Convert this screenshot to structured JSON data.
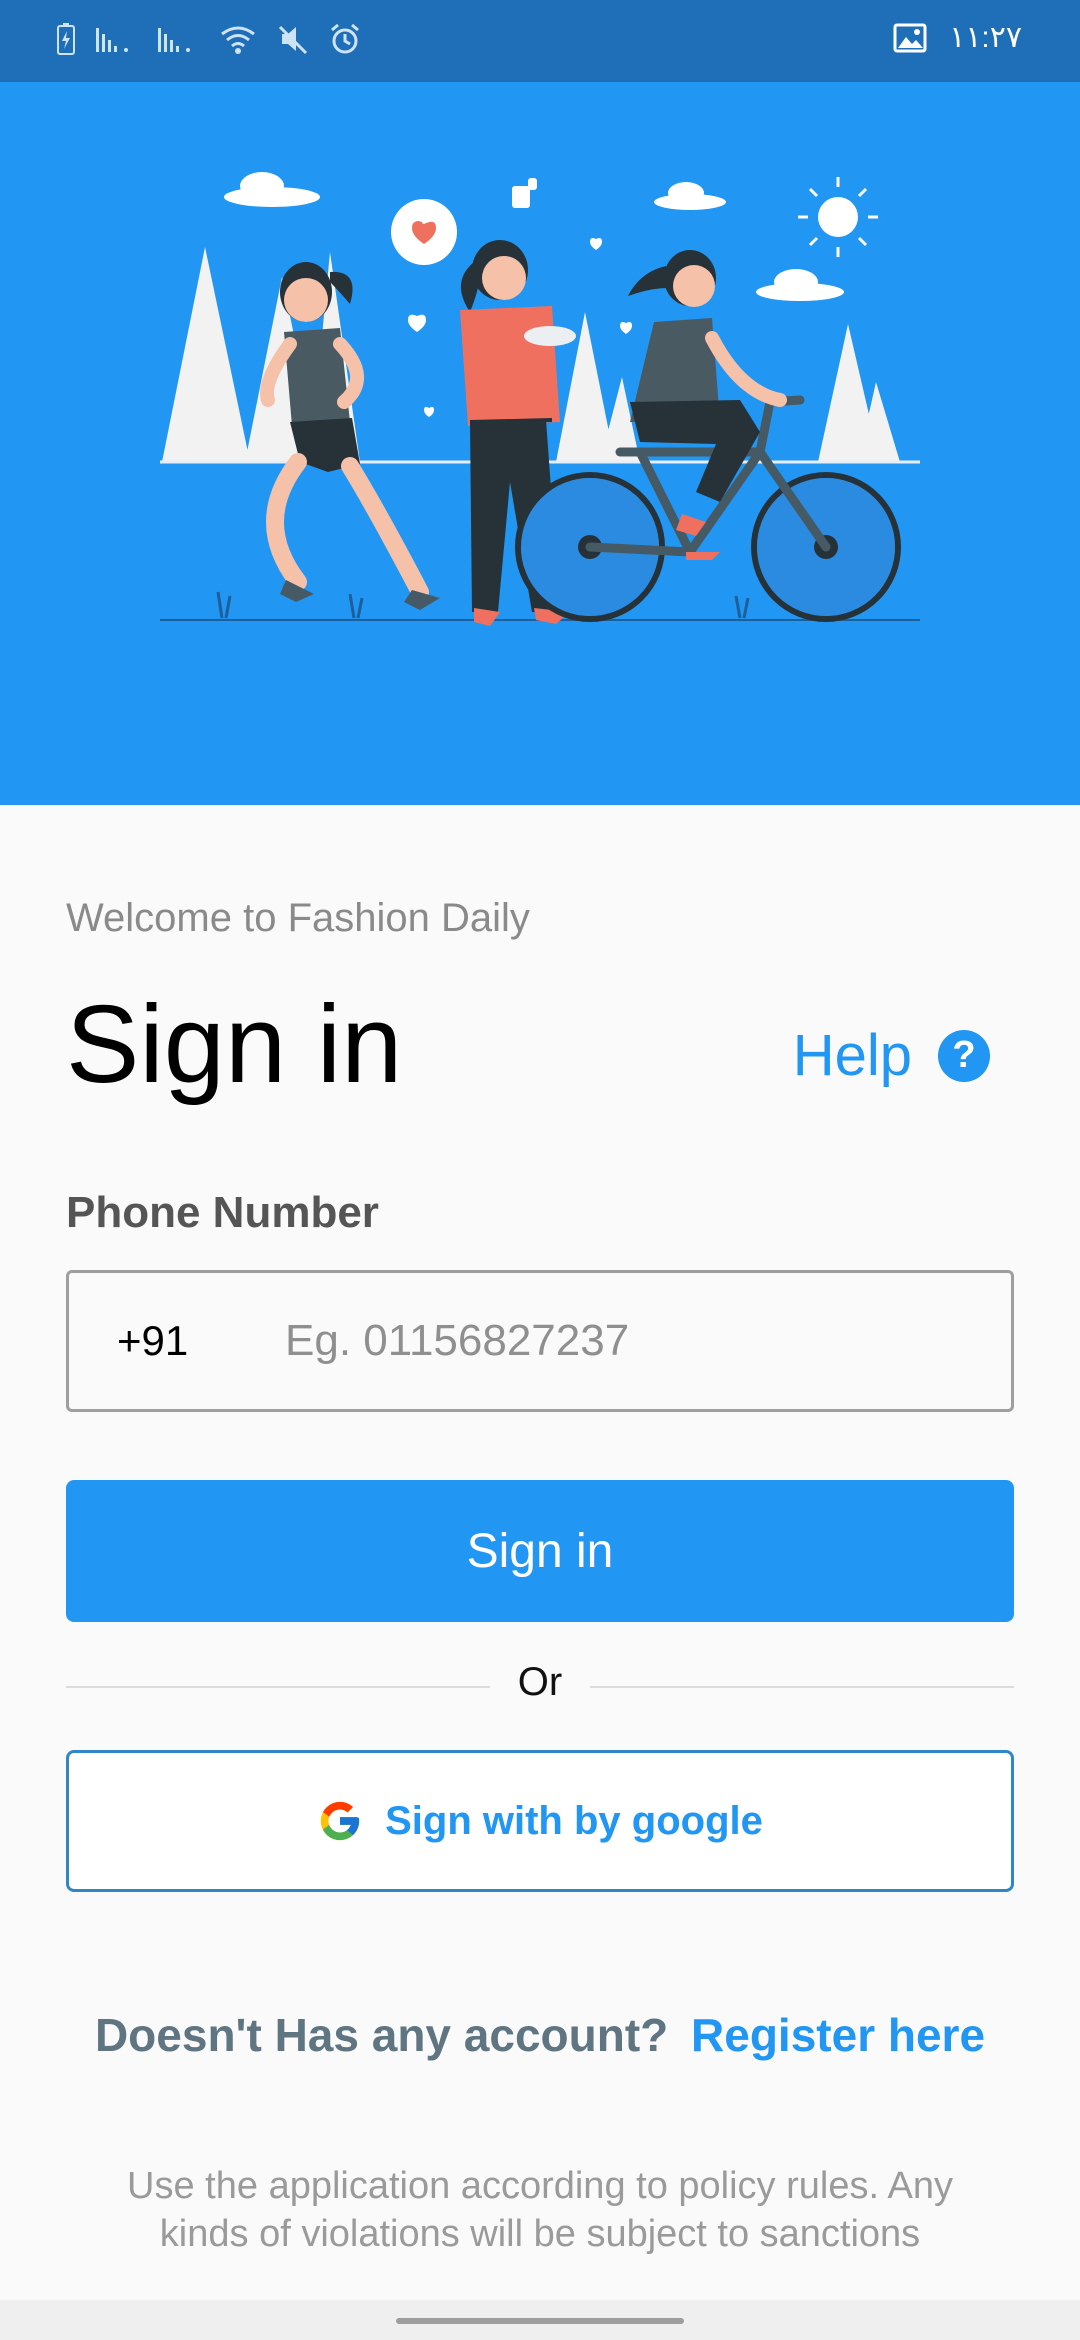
{
  "status_bar": {
    "time": "١١:٢٧",
    "icons": [
      "battery-charging-icon",
      "signal-icon",
      "signal-icon",
      "wifi-icon",
      "mute-icon",
      "alarm-icon",
      "image-icon"
    ]
  },
  "hero": {
    "illustration": "people-exercising-illustration",
    "background_color": "#2196f3"
  },
  "welcome_text": "Welcome to Fashion Daily",
  "title": "Sign in",
  "help": {
    "label": "Help",
    "icon": "help-icon"
  },
  "phone": {
    "label": "Phone Number",
    "country_code": "+91",
    "placeholder": "Eg. 01156827237",
    "value": ""
  },
  "signin_button": "Sign in",
  "divider_text": "Or",
  "google_button": {
    "label": "Sign with by google",
    "icon": "google-icon"
  },
  "register": {
    "prompt": "Doesn't Has any account?",
    "link": "Register here"
  },
  "policy_text": "Use the application according to policy rules. Any kinds of violations will be subject to sanctions",
  "colors": {
    "primary": "#2196f3",
    "status_bar": "#1f6fb8",
    "muted_text": "#8a8a8a"
  }
}
